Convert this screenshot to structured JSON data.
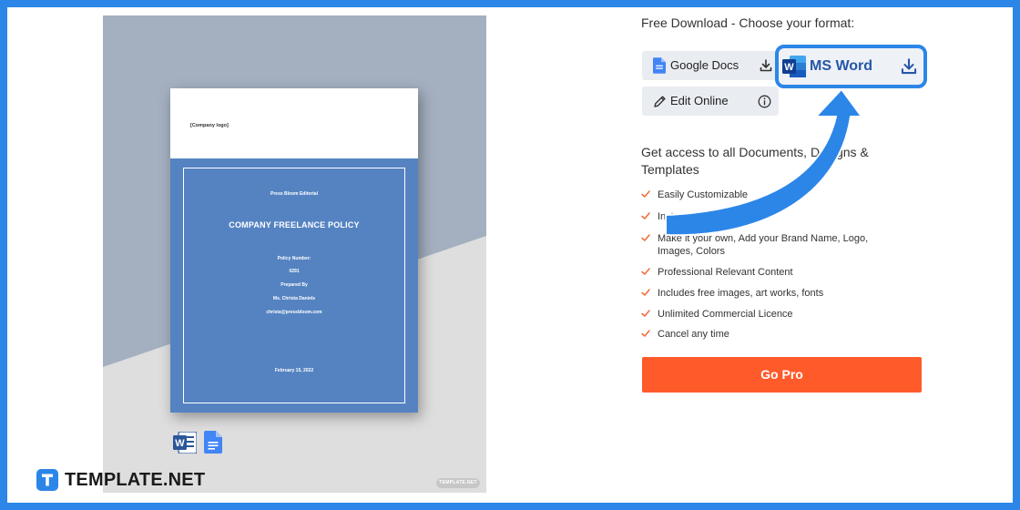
{
  "preview": {
    "company_logo": "[Company logo]",
    "publisher": "Press Bloom Editorial",
    "doc_title": "COMPANY FREELANCE POLICY",
    "policy_number_label": "Policy Number:",
    "policy_number": "0291",
    "prepared_by_label": "Prepared By",
    "prepared_by": "Ms. Christa Daniels",
    "email": "christa@pressbloom.com",
    "date": "February 15, 2022",
    "watermark": "TEMPLATE.NET",
    "format_icons": [
      "ms-word-icon",
      "google-docs-icon"
    ]
  },
  "brand": {
    "name": "TEMPLATE.NET"
  },
  "download": {
    "title": "Free Download - Choose your format:",
    "formats": [
      {
        "label": "Google Docs",
        "icon": "google-docs-icon",
        "action_icon": "download-icon"
      },
      {
        "label": "MS Word",
        "icon": "ms-word-icon",
        "action_icon": "download-icon",
        "highlighted": true
      },
      {
        "label": "Edit Online",
        "icon": "pencil-icon",
        "action_icon": "info-icon"
      }
    ]
  },
  "pro": {
    "title": "Get access to all Documents, Designs & Templates",
    "features": [
      "Easily Customizable",
      "Instant Download",
      "Make it your own, Add your Brand Name, Logo, Images, Colors",
      "Professional Relevant Content",
      "Includes free images, art works, fonts",
      "Unlimited Commercial Licence",
      "Cancel any time"
    ],
    "cta": "Go Pro"
  },
  "colors": {
    "frame": "#2b86e8",
    "cta": "#ff5a2a",
    "check": "#f26b3a",
    "cover": "#5583c2",
    "word_blue": "#2557a7"
  }
}
